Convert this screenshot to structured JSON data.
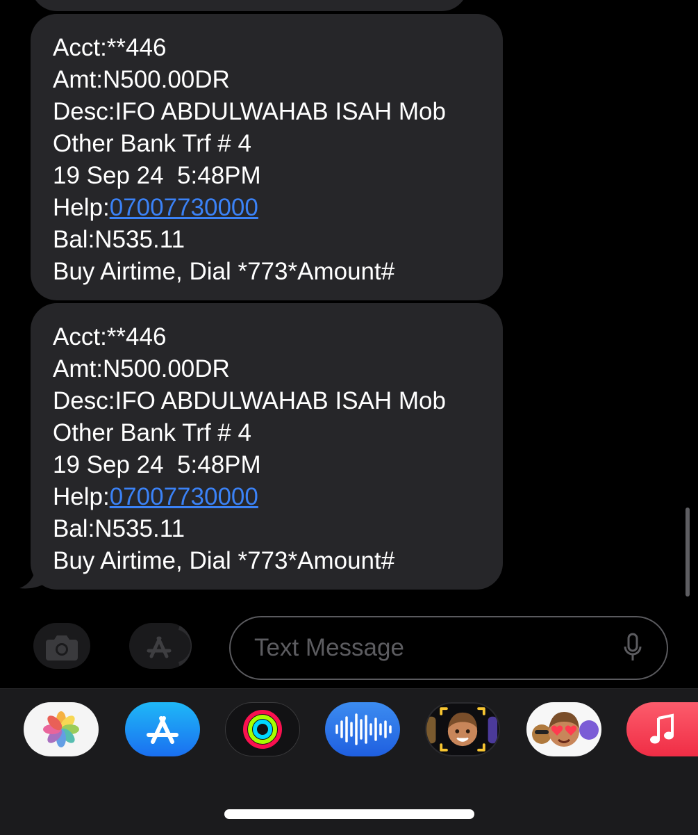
{
  "messages": [
    {
      "acct": "Acct:**446",
      "amt": "Amt:N500.00DR",
      "desc": "Desc:IFO ABDULWAHAB ISAH Mob",
      "desc2": "Other Bank Trf # 4",
      "datetime": "19 Sep 24  5:48PM",
      "help_label": "Help:",
      "help_number": "07007730000",
      "bal": "Bal:N535.11",
      "promo": "Buy Airtime, Dial *773*Amount#"
    },
    {
      "acct": "Acct:**446",
      "amt": "Amt:N500.00DR",
      "desc": "Desc:IFO ABDULWAHAB ISAH Mob",
      "desc2": "Other Bank Trf # 4",
      "datetime": "19 Sep 24  5:48PM",
      "help_label": "Help:",
      "help_number": "07007730000",
      "bal": "Bal:N535.11",
      "promo": "Buy Airtime, Dial *773*Amount#"
    }
  ],
  "composer": {
    "placeholder": "Text Message",
    "camera_icon": "camera-icon",
    "apps_icon": "app-store-icon",
    "mic_icon": "microphone-icon"
  },
  "app_tray": [
    {
      "name": "Photos",
      "icon": "photos-icon"
    },
    {
      "name": "App Store",
      "icon": "app-store-icon"
    },
    {
      "name": "Activity",
      "icon": "activity-rings-icon"
    },
    {
      "name": "Audio Message",
      "icon": "audio-waveform-icon"
    },
    {
      "name": "Memoji",
      "icon": "memoji-icon"
    },
    {
      "name": "Memoji Stickers",
      "icon": "memoji-stickers-icon"
    },
    {
      "name": "Music",
      "icon": "music-note-icon"
    }
  ],
  "colors": {
    "background": "#000000",
    "bubble": "#262629",
    "link": "#3b82f6",
    "tray": "#1b1b1d"
  }
}
